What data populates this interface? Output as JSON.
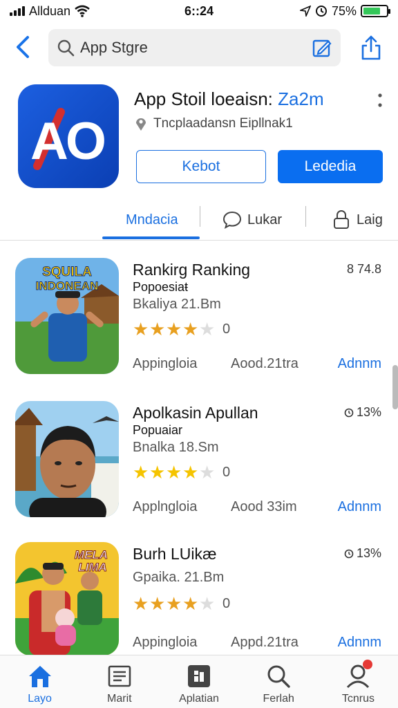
{
  "status_bar": {
    "carrier": "Allduan",
    "time": "6::24",
    "battery": "75%",
    "battery_level": 0.75
  },
  "search": {
    "placeholder": "App Stgre"
  },
  "app": {
    "icon_text": "AO",
    "title_main": "App Stoil loeaisn: ",
    "title_accent": "Za2m",
    "subtitle": "Tncplaadansn Eipllnak1",
    "btn_secondary": "Kebot",
    "btn_primary": "Lededia",
    "brand_color": "#1a6fe0"
  },
  "tabs": [
    {
      "label": "Mndacia",
      "active": true
    },
    {
      "label": "Lukar",
      "icon": "speech-bubble-icon"
    },
    {
      "label": "Laig",
      "icon": "lock-icon"
    }
  ],
  "items": [
    {
      "title": "Rankirg Ranking",
      "subtitle": "Popoesiaŧ",
      "meta": "Bkaliya 21.Bm",
      "rank": "8 74.8",
      "rating": 4,
      "star_color": "#e8a020",
      "rating_count": "0",
      "category": "Appingloia",
      "size": "Aood.21tra",
      "action": "Adnnm",
      "thumb_text": "SQUILA INDONEAN"
    },
    {
      "title": "Apolkasin Apullan",
      "subtitle": "Popuaiar",
      "meta": "Bnalka 18.Sm",
      "rank": "13%",
      "rating": 4,
      "star_color": "#f5c400",
      "rating_count": "0",
      "category": "Applngloia",
      "size": "Aood 33im",
      "action": "Adnnm",
      "thumb_text": ""
    },
    {
      "title": "Burh LUikæ",
      "subtitle": "",
      "meta": "Gpaika. 21.Bm",
      "rank": "13%",
      "rating": 4,
      "star_color": "#e8a020",
      "rating_count": "0",
      "category": "Appingloia",
      "size": "Appd.21tra",
      "action": "Adnnm",
      "thumb_text": "MELA LIMA"
    }
  ],
  "tabbar": [
    {
      "label": "Layo",
      "icon": "house-icon",
      "active": true
    },
    {
      "label": "Marit",
      "icon": "newspaper-icon"
    },
    {
      "label": "Aplatian",
      "icon": "apps-icon"
    },
    {
      "label": "Ferlah",
      "icon": "search-icon"
    },
    {
      "label": "Tcnrus",
      "icon": "person-icon",
      "badge": true
    }
  ]
}
